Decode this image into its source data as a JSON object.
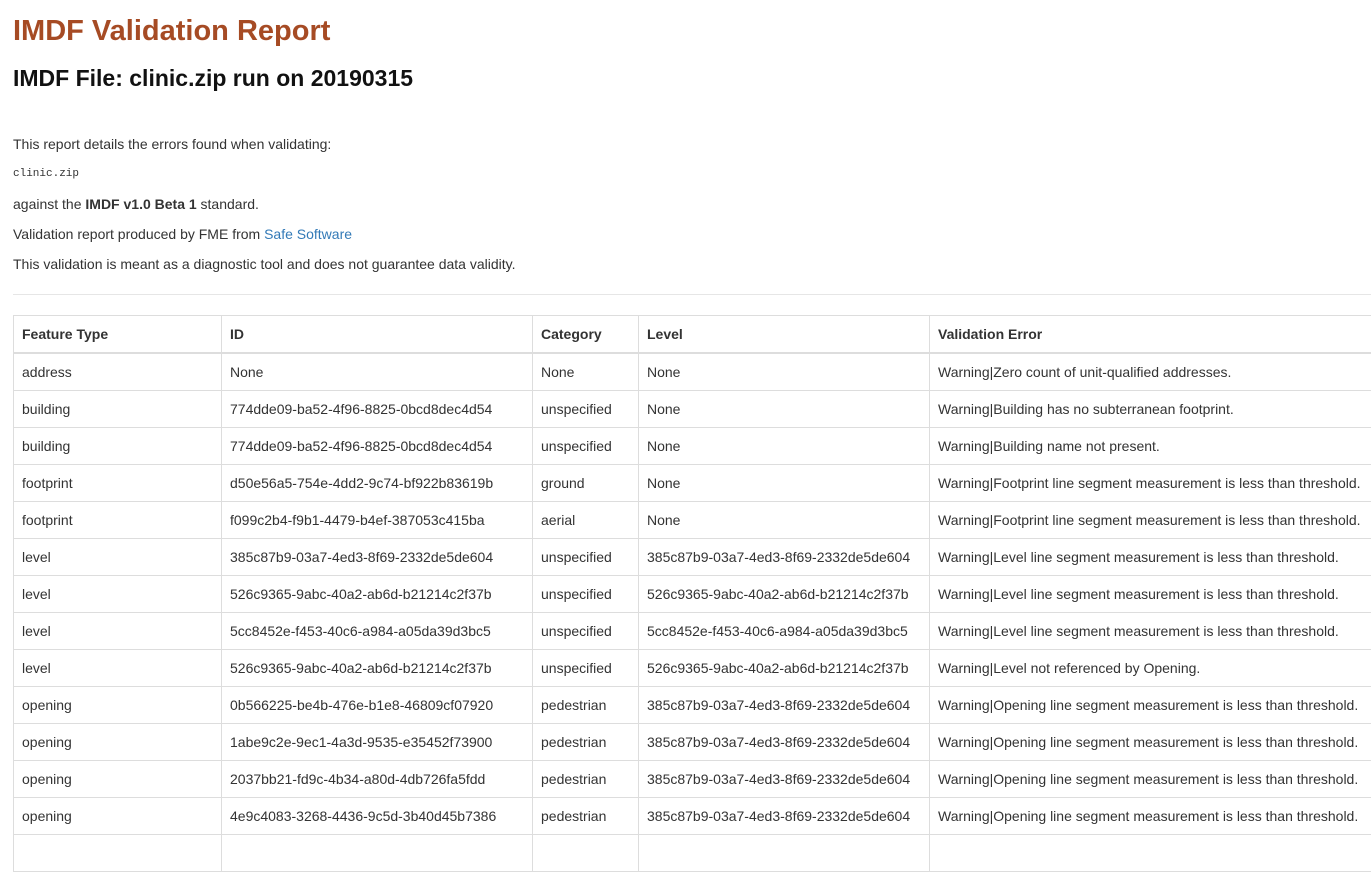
{
  "report": {
    "title": "IMDF Validation Report",
    "subtitle": "IMDF File: clinic.zip run on 20190315",
    "intro": "This report details the errors found when validating:",
    "filename": "clinic.zip",
    "against_prefix": "against the ",
    "standard": "IMDF v1.0 Beta 1",
    "against_suffix": " standard.",
    "produced_prefix": "Validation report produced by FME from ",
    "produced_link": "Safe Software",
    "disclaimer": "This validation is meant as a diagnostic tool and does not guarantee data validity."
  },
  "table": {
    "headers": [
      "Feature Type",
      "ID",
      "Category",
      "Level",
      "Validation Error"
    ],
    "rows": [
      [
        "address",
        "None",
        "None",
        "None",
        "Warning|Zero count of unit-qualified addresses."
      ],
      [
        "building",
        "774dde09-ba52-4f96-8825-0bcd8dec4d54",
        "unspecified",
        "None",
        "Warning|Building has no subterranean footprint."
      ],
      [
        "building",
        "774dde09-ba52-4f96-8825-0bcd8dec4d54",
        "unspecified",
        "None",
        "Warning|Building name not present."
      ],
      [
        "footprint",
        "d50e56a5-754e-4dd2-9c74-bf922b83619b",
        "ground",
        "None",
        "Warning|Footprint line segment measurement is less than threshold."
      ],
      [
        "footprint",
        "f099c2b4-f9b1-4479-b4ef-387053c415ba",
        "aerial",
        "None",
        "Warning|Footprint line segment measurement is less than threshold."
      ],
      [
        "level",
        "385c87b9-03a7-4ed3-8f69-2332de5de604",
        "unspecified",
        "385c87b9-03a7-4ed3-8f69-2332de5de604",
        "Warning|Level line segment measurement is less than threshold."
      ],
      [
        "level",
        "526c9365-9abc-40a2-ab6d-b21214c2f37b",
        "unspecified",
        "526c9365-9abc-40a2-ab6d-b21214c2f37b",
        "Warning|Level line segment measurement is less than threshold."
      ],
      [
        "level",
        "5cc8452e-f453-40c6-a984-a05da39d3bc5",
        "unspecified",
        "5cc8452e-f453-40c6-a984-a05da39d3bc5",
        "Warning|Level line segment measurement is less than threshold."
      ],
      [
        "level",
        "526c9365-9abc-40a2-ab6d-b21214c2f37b",
        "unspecified",
        "526c9365-9abc-40a2-ab6d-b21214c2f37b",
        "Warning|Level not referenced by Opening."
      ],
      [
        "opening",
        "0b566225-be4b-476e-b1e8-46809cf07920",
        "pedestrian",
        "385c87b9-03a7-4ed3-8f69-2332de5de604",
        "Warning|Opening line segment measurement is less than threshold."
      ],
      [
        "opening",
        "1abe9c2e-9ec1-4a3d-9535-e35452f73900",
        "pedestrian",
        "385c87b9-03a7-4ed3-8f69-2332de5de604",
        "Warning|Opening line segment measurement is less than threshold."
      ],
      [
        "opening",
        "2037bb21-fd9c-4b34-a80d-4db726fa5fdd",
        "pedestrian",
        "385c87b9-03a7-4ed3-8f69-2332de5de604",
        "Warning|Opening line segment measurement is less than threshold."
      ],
      [
        "opening",
        "4e9c4083-3268-4436-9c5d-3b40d45b7386",
        "pedestrian",
        "385c87b9-03a7-4ed3-8f69-2332de5de604",
        "Warning|Opening line segment measurement is less than threshold."
      ],
      [
        "",
        "",
        "",
        "",
        ""
      ]
    ]
  }
}
